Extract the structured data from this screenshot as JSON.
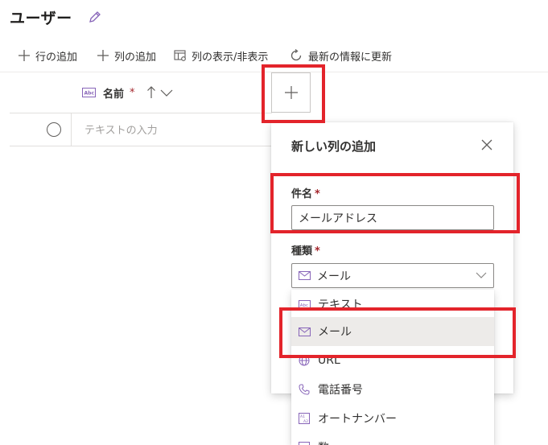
{
  "page": {
    "title": "ユーザー"
  },
  "toolbar": {
    "add_row": "行の追加",
    "add_column": "列の追加",
    "show_hide_columns": "列の表示/非表示",
    "refresh": "最新の情報に更新"
  },
  "grid": {
    "column_name": "名前",
    "required_mark": "*",
    "text_placeholder": "テキストの入力"
  },
  "panel": {
    "title": "新しい列の追加",
    "name_label": "件名",
    "name_value": "メールアドレス",
    "type_label": "種類",
    "type_selected": "メール",
    "required_mark": "*"
  },
  "dropdown": {
    "options": [
      "テキスト",
      "メール",
      "URL",
      "電話番号",
      "オートナンバー",
      "数"
    ]
  },
  "colors": {
    "accent": "#8764b8",
    "highlight": "#e3242b",
    "required": "#a4262c"
  }
}
